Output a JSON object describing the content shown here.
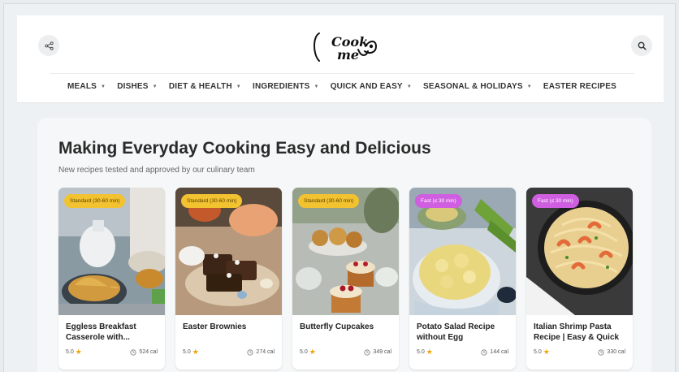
{
  "header": {
    "logo_text_line1": "Cook",
    "logo_text_line2": "me",
    "share_icon": "share-icon",
    "search_icon": "search-icon"
  },
  "nav": [
    {
      "label": "MEALS",
      "dropdown": true
    },
    {
      "label": "DISHES",
      "dropdown": true
    },
    {
      "label": "DIET & HEALTH",
      "dropdown": true
    },
    {
      "label": "INGREDIENTS",
      "dropdown": true
    },
    {
      "label": "QUICK AND EASY",
      "dropdown": true
    },
    {
      "label": "SEASONAL & HOLIDAYS",
      "dropdown": true
    },
    {
      "label": "EASTER RECIPES",
      "dropdown": false
    }
  ],
  "main": {
    "title": "Making Everyday Cooking Easy and Delicious",
    "subtitle": "New recipes tested and approved by our culinary team"
  },
  "cards": [
    {
      "badge": "Standard (30-60 min)",
      "badge_type": "standard",
      "title": "Eggless Breakfast Casserole with...",
      "rating": "5.0",
      "calories": "524 cal"
    },
    {
      "badge": "Standard (30-60 min)",
      "badge_type": "standard",
      "title": "Easter Brownies",
      "rating": "5.0",
      "calories": "274 cal"
    },
    {
      "badge": "Standard (30-60 min)",
      "badge_type": "standard",
      "title": "Butterfly Cupcakes",
      "rating": "5.0",
      "calories": "349 cal"
    },
    {
      "badge": "Fast (≤ 30 min)",
      "badge_type": "fast",
      "title": "Potato Salad Recipe without Egg",
      "rating": "5.0",
      "calories": "144 cal"
    },
    {
      "badge": "Fast (≤ 30 min)",
      "badge_type": "fast",
      "title": "Italian Shrimp Pasta Recipe | Easy & Quick",
      "rating": "5.0",
      "calories": "330 cal"
    }
  ],
  "colors": {
    "badge_standard": "#f2c230",
    "badge_fast": "#d05ee0",
    "star": "#f0a500"
  }
}
